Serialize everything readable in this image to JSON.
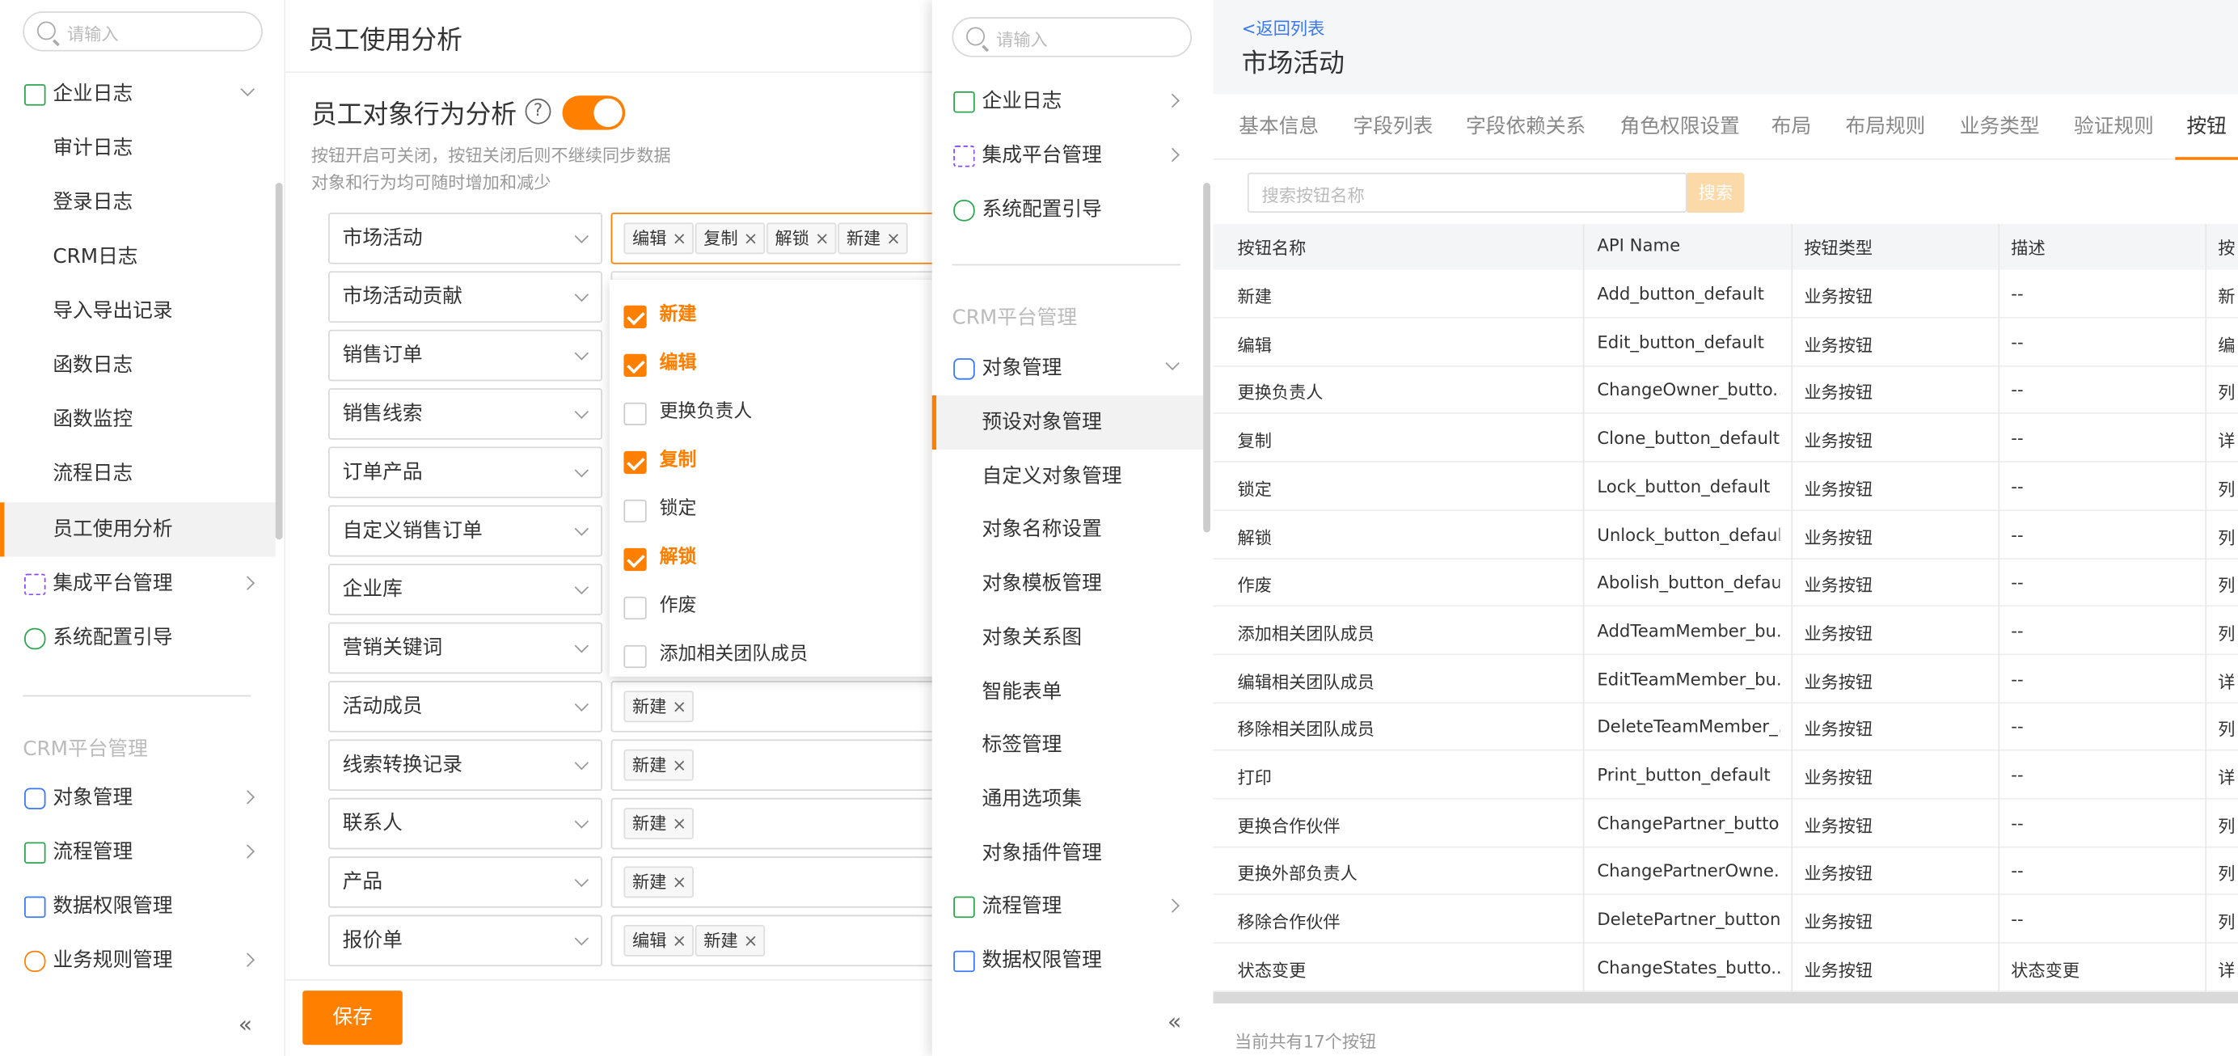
{
  "left_sidebar": {
    "search_placeholder": "请输入",
    "items": [
      {
        "label": "企业日志"
      },
      {
        "label": "集成平台管理"
      },
      {
        "label": "系统配置引导"
      }
    ],
    "sub_items": [
      "审计日志",
      "登录日志",
      "CRM日志",
      "导入导出记录",
      "函数日志",
      "函数监控",
      "流程日志",
      "员工使用分析"
    ],
    "section_label": "CRM平台管理",
    "crm_items": [
      "对象管理",
      "流程管理",
      "数据权限管理",
      "业务规则管理"
    ],
    "collapse_symbol": "«"
  },
  "main": {
    "page_title": "员工使用分析",
    "section_title": "员工对象行为分析",
    "help_symbol": "?",
    "desc1": "按钮开启可关闭，按钮关闭后则不继续同步数据",
    "desc2": "对象和行为均可随时增加和减少",
    "save_label": "保存",
    "tag_close": "×",
    "rows": [
      {
        "object": "市场活动",
        "tags": [
          "编辑",
          "复制",
          "解锁",
          "新建"
        ]
      },
      {
        "object": "市场活动贡献",
        "tags": []
      },
      {
        "object": "销售订单",
        "tags": []
      },
      {
        "object": "销售线索",
        "tags": []
      },
      {
        "object": "订单产品",
        "tags": []
      },
      {
        "object": "自定义销售订单",
        "tags": []
      },
      {
        "object": "企业库",
        "tags": []
      },
      {
        "object": "营销关键词",
        "tags": []
      },
      {
        "object": "活动成员",
        "tags": [
          "新建"
        ]
      },
      {
        "object": "线索转换记录",
        "tags": [
          "新建"
        ]
      },
      {
        "object": "联系人",
        "tags": [
          "新建"
        ]
      },
      {
        "object": "产品",
        "tags": [
          "新建"
        ]
      },
      {
        "object": "报价单",
        "tags": [
          "编辑",
          "新建"
        ]
      }
    ]
  },
  "dropdown": {
    "options": [
      {
        "label": "新建",
        "checked": true
      },
      {
        "label": "编辑",
        "checked": true
      },
      {
        "label": "更换负责人",
        "checked": false
      },
      {
        "label": "复制",
        "checked": true
      },
      {
        "label": "锁定",
        "checked": false
      },
      {
        "label": "解锁",
        "checked": true
      },
      {
        "label": "作废",
        "checked": false
      },
      {
        "label": "添加相关团队成员",
        "checked": false
      }
    ]
  },
  "sidebar2": {
    "search_placeholder": "请输入",
    "items": [
      "企业日志",
      "集成平台管理",
      "系统配置引导"
    ],
    "section_label": "CRM平台管理",
    "object_mgmt": "对象管理",
    "sub_items": [
      "预设对象管理",
      "自定义对象管理",
      "对象名称设置",
      "对象模板管理",
      "对象关系图",
      "智能表单",
      "标签管理",
      "通用选项集",
      "对象插件管理"
    ],
    "more_items": [
      "流程管理",
      "数据权限管理"
    ],
    "collapse_symbol": "«"
  },
  "rightpanel": {
    "back_link": "<返回列表",
    "title": "市场活动",
    "tabs": [
      "基本信息",
      "字段列表",
      "字段依赖关系",
      "角色权限设置",
      "布局",
      "布局规则",
      "业务类型",
      "验证规则",
      "按钮"
    ],
    "active_tab": "按钮",
    "search_placeholder": "搜索按钮名称",
    "search_button": "搜索",
    "columns": [
      "按钮名称",
      "API Name",
      "按钮类型",
      "描述",
      "按"
    ],
    "rows": [
      [
        "新建",
        "Add_button_default",
        "业务按钮",
        "--",
        "新"
      ],
      [
        "编辑",
        "Edit_button_default",
        "业务按钮",
        "--",
        "编"
      ],
      [
        "更换负责人",
        "ChangeOwner_butto...",
        "业务按钮",
        "--",
        "列"
      ],
      [
        "复制",
        "Clone_button_default",
        "业务按钮",
        "--",
        "详"
      ],
      [
        "锁定",
        "Lock_button_default",
        "业务按钮",
        "--",
        "列"
      ],
      [
        "解锁",
        "Unlock_button_default",
        "业务按钮",
        "--",
        "列"
      ],
      [
        "作废",
        "Abolish_button_default",
        "业务按钮",
        "--",
        "列"
      ],
      [
        "添加相关团队成员",
        "AddTeamMember_bu...",
        "业务按钮",
        "--",
        "列"
      ],
      [
        "编辑相关团队成员",
        "EditTeamMember_bu...",
        "业务按钮",
        "--",
        "详"
      ],
      [
        "移除相关团队成员",
        "DeleteTeamMember_...",
        "业务按钮",
        "--",
        "列"
      ],
      [
        "打印",
        "Print_button_default",
        "业务按钮",
        "--",
        "详"
      ],
      [
        "更换合作伙伴",
        "ChangePartner_butto...",
        "业务按钮",
        "--",
        "列"
      ],
      [
        "更换外部负责人",
        "ChangePartnerOwne...",
        "业务按钮",
        "--",
        "列"
      ],
      [
        "移除合作伙伴",
        "DeletePartner_button...",
        "业务按钮",
        "--",
        "列"
      ],
      [
        "状态变更",
        "ChangeStates_butto...",
        "业务按钮",
        "状态变更",
        "详"
      ]
    ],
    "footer": "当前共有17个按钮"
  },
  "colors": {
    "accent": "#ff8000",
    "link": "#3a78f2"
  }
}
